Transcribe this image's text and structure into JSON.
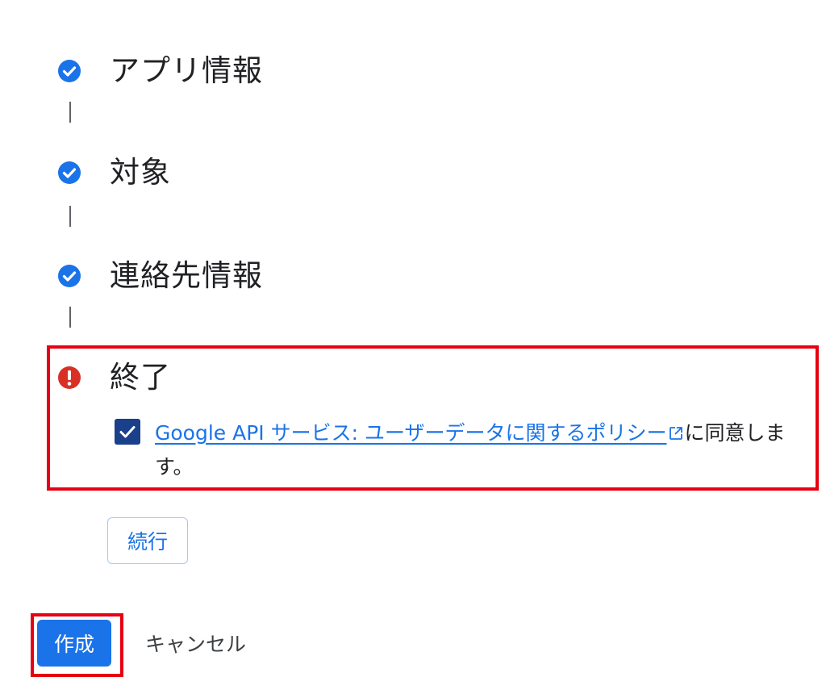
{
  "steps": [
    {
      "label": "アプリ情報",
      "status": "complete",
      "icon": "check-circle-icon"
    },
    {
      "label": "対象",
      "status": "complete",
      "icon": "check-circle-icon"
    },
    {
      "label": "連絡先情報",
      "status": "complete",
      "icon": "check-circle-icon"
    },
    {
      "label": "終了",
      "status": "error",
      "icon": "error-circle-icon"
    }
  ],
  "agreement": {
    "checked": true,
    "link_text": "Google API サービス: ユーザーデータに関するポリシー",
    "suffix_text": "に同意します。"
  },
  "buttons": {
    "continue_label": "続行",
    "create_label": "作成",
    "cancel_label": "キャンセル"
  },
  "colors": {
    "step_complete": "#1a73e8",
    "step_error": "#d93025",
    "highlight": "#e60012",
    "checkbox": "#1a3f8b",
    "link": "#1a73e8",
    "primary_button": "#1a73e8"
  }
}
